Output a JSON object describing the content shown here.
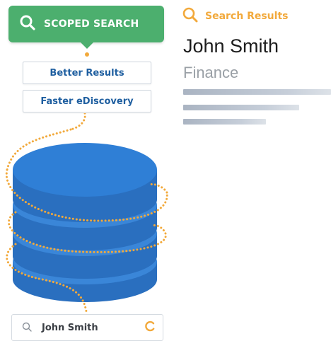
{
  "badge": {
    "label": "SCOPED SEARCH",
    "icon": "search-icon",
    "color": "#4caf6e"
  },
  "features": [
    {
      "label": "Better Results"
    },
    {
      "label": "Faster eDiscovery"
    }
  ],
  "illustration": {
    "icon": "database-icon",
    "color_top": "#2f7fd6",
    "color_side": "#2a6fbf",
    "path_color": "#f2a93b"
  },
  "search": {
    "query": "John Smith",
    "icon": "search-icon",
    "status_icon": "loading-spinner-icon"
  },
  "results": {
    "title": "Search Results",
    "icon": "search-icon",
    "accent": "#f2a93b",
    "name": "John Smith",
    "department": "Finance"
  }
}
